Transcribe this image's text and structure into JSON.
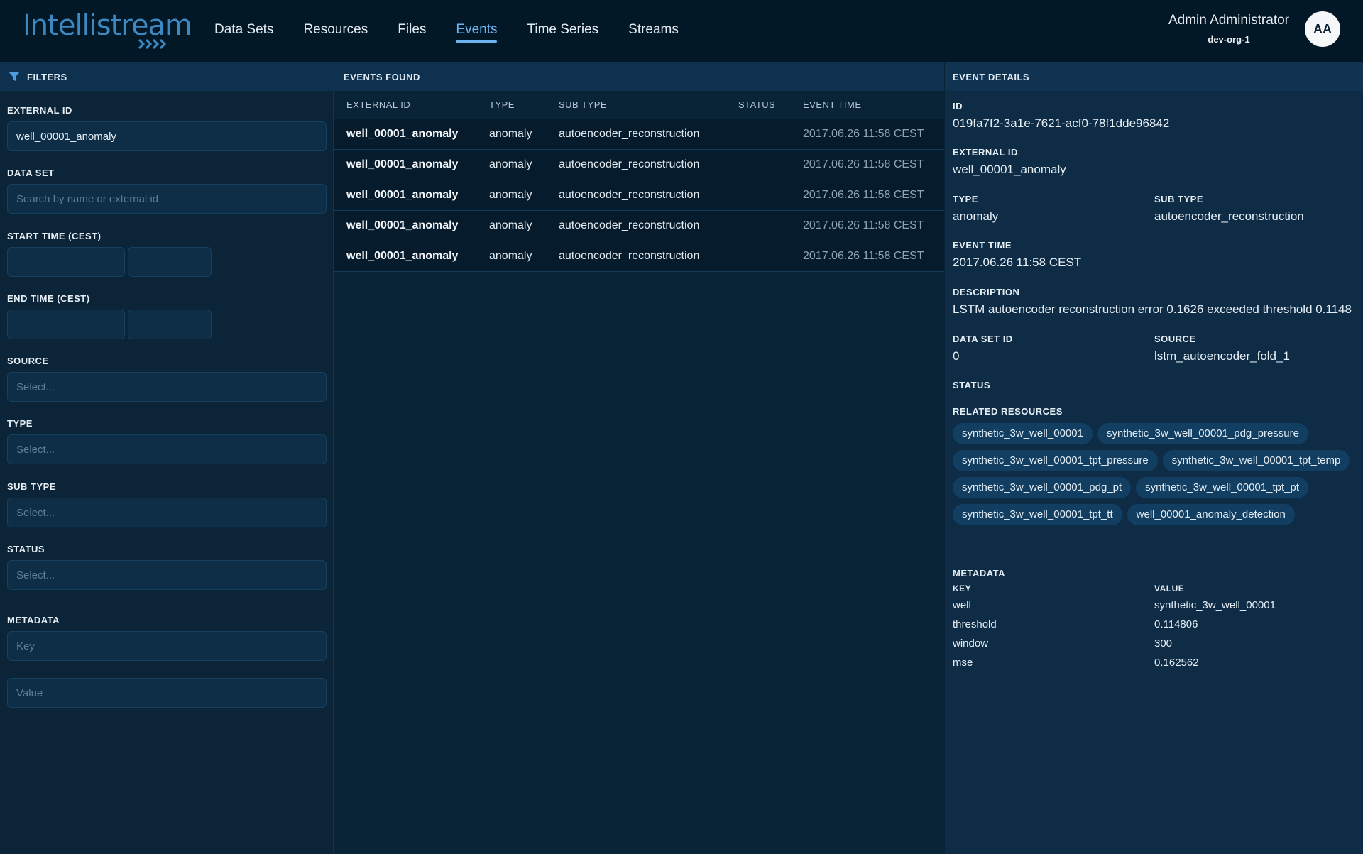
{
  "app": {
    "logo_text": "Intellistream",
    "nav": [
      "Data Sets",
      "Resources",
      "Files",
      "Events",
      "Time Series",
      "Streams"
    ],
    "active_nav": "Events",
    "user_name": "Admin Administrator",
    "user_org": "dev-org-1",
    "avatar_initials": "AA"
  },
  "filters": {
    "title": "FILTERS",
    "external_id_label": "EXTERNAL ID",
    "external_id_value": "well_00001_anomaly",
    "data_set_label": "DATA SET",
    "data_set_placeholder": "Search by name or external id",
    "start_time_label": "START TIME (CEST)",
    "end_time_label": "END TIME (CEST)",
    "source_label": "SOURCE",
    "source_placeholder": "Select...",
    "type_label": "TYPE",
    "type_placeholder": "Select...",
    "sub_type_label": "SUB TYPE",
    "sub_type_placeholder": "Select...",
    "status_label": "STATUS",
    "status_placeholder": "Select...",
    "metadata_label": "METADATA",
    "metadata_key_placeholder": "Key",
    "metadata_value_placeholder": "Value"
  },
  "events": {
    "title": "EVENTS FOUND",
    "columns": [
      "EXTERNAL ID",
      "TYPE",
      "SUB TYPE",
      "STATUS",
      "EVENT TIME"
    ],
    "rows": [
      {
        "external_id": "well_00001_anomaly",
        "type": "anomaly",
        "sub_type": "autoencoder_reconstruction",
        "status": "",
        "event_time": "2017.06.26 11:58 CEST"
      },
      {
        "external_id": "well_00001_anomaly",
        "type": "anomaly",
        "sub_type": "autoencoder_reconstruction",
        "status": "",
        "event_time": "2017.06.26 11:58 CEST"
      },
      {
        "external_id": "well_00001_anomaly",
        "type": "anomaly",
        "sub_type": "autoencoder_reconstruction",
        "status": "",
        "event_time": "2017.06.26 11:58 CEST"
      },
      {
        "external_id": "well_00001_anomaly",
        "type": "anomaly",
        "sub_type": "autoencoder_reconstruction",
        "status": "",
        "event_time": "2017.06.26 11:58 CEST"
      },
      {
        "external_id": "well_00001_anomaly",
        "type": "anomaly",
        "sub_type": "autoencoder_reconstruction",
        "status": "",
        "event_time": "2017.06.26 11:58 CEST"
      }
    ]
  },
  "details": {
    "title": "EVENT DETAILS",
    "id_label": "ID",
    "id": "019fa7f2-3a1e-7621-acf0-78f1dde96842",
    "external_id_label": "EXTERNAL ID",
    "external_id": "well_00001_anomaly",
    "type_label": "TYPE",
    "type": "anomaly",
    "sub_type_label": "SUB TYPE",
    "sub_type": "autoencoder_reconstruction",
    "event_time_label": "EVENT TIME",
    "event_time": "2017.06.26 11:58 CEST",
    "description_label": "DESCRIPTION",
    "description": "LSTM autoencoder reconstruction error 0.1626 exceeded threshold 0.1148",
    "data_set_id_label": "DATA SET ID",
    "data_set_id": "0",
    "source_label": "SOURCE",
    "source": "lstm_autoencoder_fold_1",
    "status_label": "STATUS",
    "related_label": "RELATED RESOURCES",
    "related": [
      "synthetic_3w_well_00001",
      "synthetic_3w_well_00001_pdg_pressure",
      "synthetic_3w_well_00001_tpt_pressure",
      "synthetic_3w_well_00001_tpt_temp",
      "synthetic_3w_well_00001_pdg_pt",
      "synthetic_3w_well_00001_tpt_pt",
      "synthetic_3w_well_00001_tpt_tt",
      "well_00001_anomaly_detection"
    ],
    "metadata_label": "METADATA",
    "metadata_key_header": "KEY",
    "metadata_value_header": "VALUE",
    "metadata": [
      {
        "key": "well",
        "value": "synthetic_3w_well_00001"
      },
      {
        "key": "threshold",
        "value": "0.114806"
      },
      {
        "key": "window",
        "value": "300"
      },
      {
        "key": "mse",
        "value": "0.162562"
      }
    ]
  }
}
